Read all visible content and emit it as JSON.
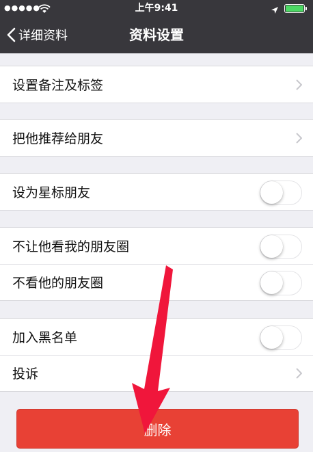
{
  "status_bar": {
    "signal": "●●●●●",
    "time": "上午9:41"
  },
  "nav": {
    "back_label": "详细资料",
    "title": "资料设置"
  },
  "groups": [
    {
      "rows": [
        {
          "label": "设置备注及标签",
          "control": "chevron"
        }
      ]
    },
    {
      "rows": [
        {
          "label": "把他推荐给朋友",
          "control": "chevron"
        }
      ]
    },
    {
      "rows": [
        {
          "label": "设为星标朋友",
          "control": "toggle",
          "on": false
        }
      ]
    },
    {
      "rows": [
        {
          "label": "不让他看我的朋友圈",
          "control": "toggle",
          "on": false
        },
        {
          "label": "不看他的朋友圈",
          "control": "toggle",
          "on": false
        }
      ]
    },
    {
      "rows": [
        {
          "label": "加入黑名单",
          "control": "toggle",
          "on": false
        },
        {
          "label": "投诉",
          "control": "chevron"
        }
      ]
    }
  ],
  "delete_button": {
    "label": "删除"
  },
  "colors": {
    "navbar": "#38373c",
    "background": "#efeff4",
    "delete": "#e84135",
    "annotation_arrow": "#f0163b",
    "battery": "#4cd964"
  }
}
